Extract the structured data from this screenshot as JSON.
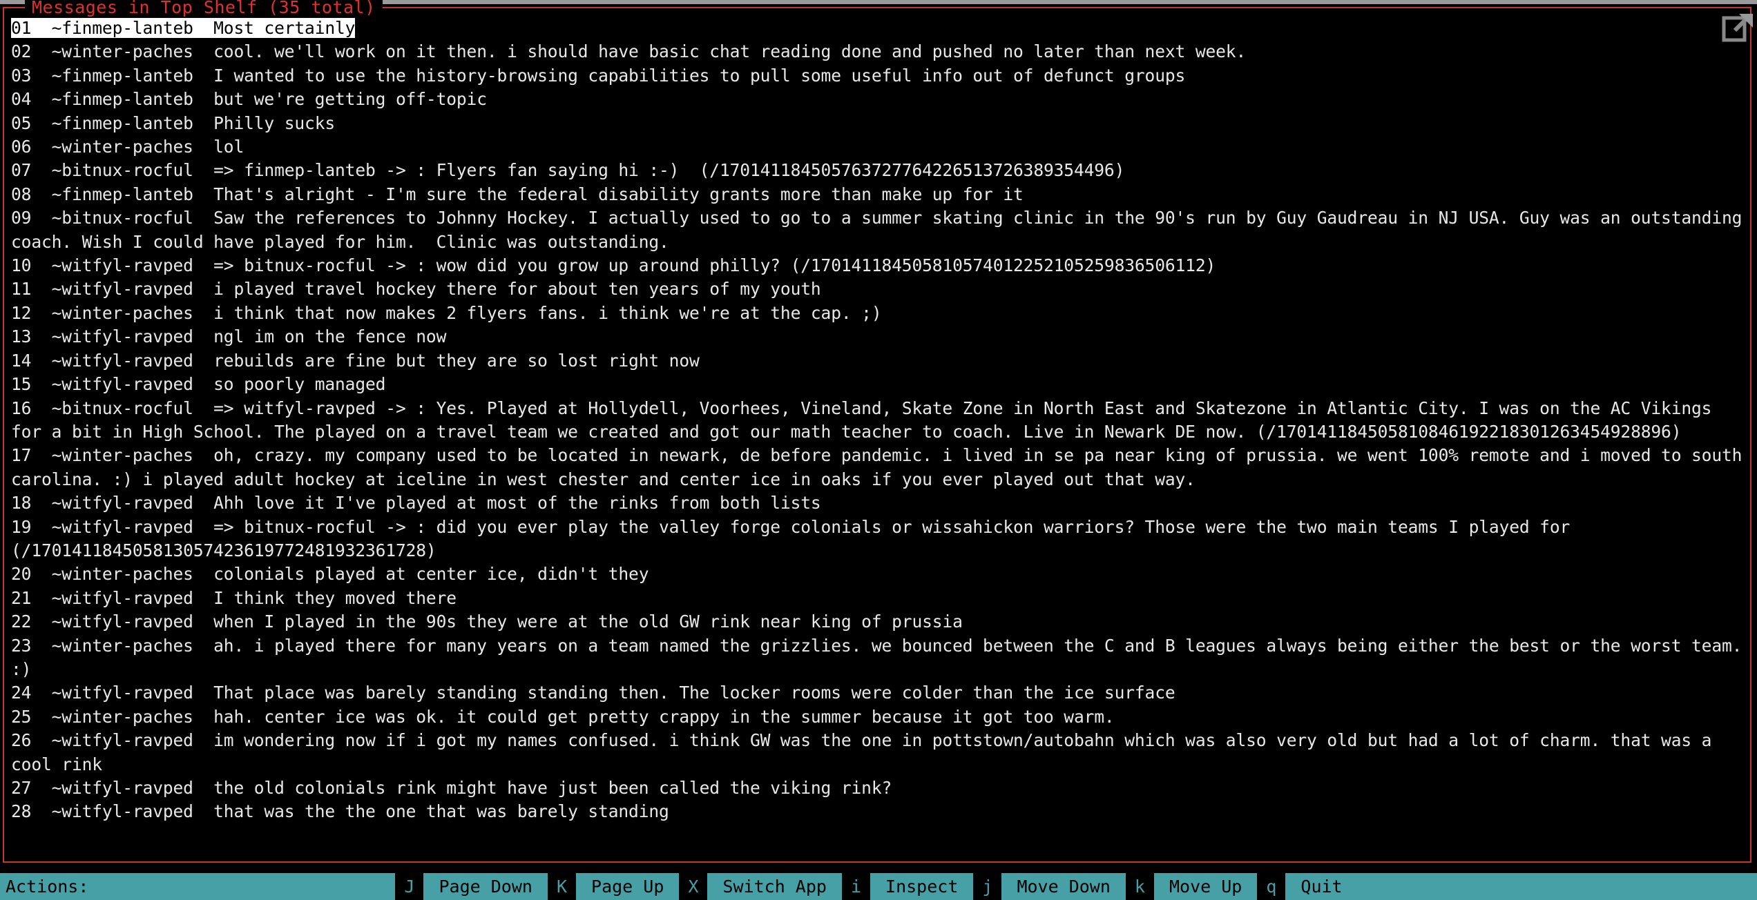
{
  "window": {
    "panel_title": "─ Messages in Top Shelf (35 total) ──────────────────────────────────────────────────────────────────────────────────────────────────────────────────────────────────────────────────────────────────────────────────────────────────────────────────────────────────────",
    "title_text": "Messages in Top Shelf (35 total)",
    "border_color": "#c0392b",
    "title_color": "#e03030",
    "background_color": "#000000",
    "expand_icon": "expand-window-icon"
  },
  "messages": [
    {
      "num": "01",
      "author": "~finmep-lanteb",
      "text": "Most certainly",
      "selected": true
    },
    {
      "num": "02",
      "author": "~winter-paches",
      "text": "cool. we'll work on it then. i should have basic chat reading done and pushed no later than next week.",
      "selected": false
    },
    {
      "num": "03",
      "author": "~finmep-lanteb",
      "text": "I wanted to use the history-browsing capabilities to pull some useful info out of defunct groups",
      "selected": false
    },
    {
      "num": "04",
      "author": "~finmep-lanteb",
      "text": "but we're getting off-topic",
      "selected": false
    },
    {
      "num": "05",
      "author": "~finmep-lanteb",
      "text": "Philly sucks",
      "selected": false
    },
    {
      "num": "06",
      "author": "~winter-paches",
      "text": "lol",
      "selected": false
    },
    {
      "num": "07",
      "author": "~bitnux-rocful",
      "text": "=> finmep-lanteb -> : Flyers fan saying hi :-)  (/170141184505763727764226513726389354496)",
      "selected": false
    },
    {
      "num": "08",
      "author": "~finmep-lanteb",
      "text": "That's alright - I'm sure the federal disability grants more than make up for it",
      "selected": false
    },
    {
      "num": "09",
      "author": "~bitnux-rocful",
      "text": "Saw the references to Johnny Hockey. I actually used to go to a summer skating clinic in the 90's run by Guy Gaudreau in NJ USA. Guy was an outstanding coach. Wish I could have played for him.  Clinic was outstanding.",
      "selected": false
    },
    {
      "num": "10",
      "author": "~witfyl-ravped",
      "text": "=> bitnux-rocful -> : wow did you grow up around philly? (/170141184505810574012252105259836506112)",
      "selected": false
    },
    {
      "num": "11",
      "author": "~witfyl-ravped",
      "text": "i played travel hockey there for about ten years of my youth",
      "selected": false
    },
    {
      "num": "12",
      "author": "~winter-paches",
      "text": "i think that now makes 2 flyers fans. i think we're at the cap. ;)",
      "selected": false
    },
    {
      "num": "13",
      "author": "~witfyl-ravped",
      "text": "ngl im on the fence now",
      "selected": false
    },
    {
      "num": "14",
      "author": "~witfyl-ravped",
      "text": "rebuilds are fine but they are so lost right now",
      "selected": false
    },
    {
      "num": "15",
      "author": "~witfyl-ravped",
      "text": "so poorly managed",
      "selected": false
    },
    {
      "num": "16",
      "author": "~bitnux-rocful",
      "text": "=> witfyl-ravped -> : Yes. Played at Hollydell, Voorhees, Vineland, Skate Zone in North East and Skatezone in Atlantic City. I was on the AC Vikings for a bit in High School. The played on a travel team we created and got our math teacher to coach. Live in Newark DE now. (/170141184505810846192218301263454928896)",
      "selected": false
    },
    {
      "num": "17",
      "author": "~winter-paches",
      "text": "oh, crazy. my company used to be located in newark, de before pandemic. i lived in se pa near king of prussia. we went 100% remote and i moved to south carolina. :) i played adult hockey at iceline in west chester and center ice in oaks if you ever played out that way.",
      "selected": false
    },
    {
      "num": "18",
      "author": "~witfyl-ravped",
      "text": "Ahh love it I've played at most of the rinks from both lists",
      "selected": false
    },
    {
      "num": "19",
      "author": "~witfyl-ravped",
      "text": "=> bitnux-rocful -> : did you ever play the valley forge colonials or wissahickon warriors? Those were the two main teams I played for (/170141184505813057423619772481932361728)",
      "selected": false
    },
    {
      "num": "20",
      "author": "~winter-paches",
      "text": "colonials played at center ice, didn't they",
      "selected": false
    },
    {
      "num": "21",
      "author": "~witfyl-ravped",
      "text": "I think they moved there",
      "selected": false
    },
    {
      "num": "22",
      "author": "~witfyl-ravped",
      "text": "when I played in the 90s they were at the old GW rink near king of prussia",
      "selected": false
    },
    {
      "num": "23",
      "author": "~winter-paches",
      "text": "ah. i played there for many years on a team named the grizzlies. we bounced between the C and B leagues always being either the best or the worst team. :)",
      "selected": false
    },
    {
      "num": "24",
      "author": "~witfyl-ravped",
      "text": "That place was barely standing standing then. The locker rooms were colder than the ice surface",
      "selected": false
    },
    {
      "num": "25",
      "author": "~winter-paches",
      "text": "hah. center ice was ok. it could get pretty crappy in the summer because it got too warm.",
      "selected": false
    },
    {
      "num": "26",
      "author": "~witfyl-ravped",
      "text": "im wondering now if i got my names confused. i think GW was the one in pottstown/autobahn which was also very old but had a lot of charm. that was a cool rink",
      "selected": false
    },
    {
      "num": "27",
      "author": "~witfyl-ravped",
      "text": "the old colonials rink might have just been called the viking rink?",
      "selected": false
    },
    {
      "num": "28",
      "author": "~witfyl-ravped",
      "text": "that was the the one that was barely standing",
      "selected": false
    }
  ],
  "action_bar": {
    "label": "Actions:",
    "background_color": "#46a0a5",
    "key_background_color": "#000000",
    "key_text_color": "#46a0a5",
    "label_text_color": "#000000",
    "items": [
      {
        "key": "J",
        "label": "Page Down"
      },
      {
        "key": "K",
        "label": "Page Up"
      },
      {
        "key": "X",
        "label": "Switch App"
      },
      {
        "key": "i",
        "label": "Inspect"
      },
      {
        "key": "j",
        "label": "Move Down"
      },
      {
        "key": "k",
        "label": "Move Up"
      },
      {
        "key": "q",
        "label": "Quit"
      }
    ]
  }
}
